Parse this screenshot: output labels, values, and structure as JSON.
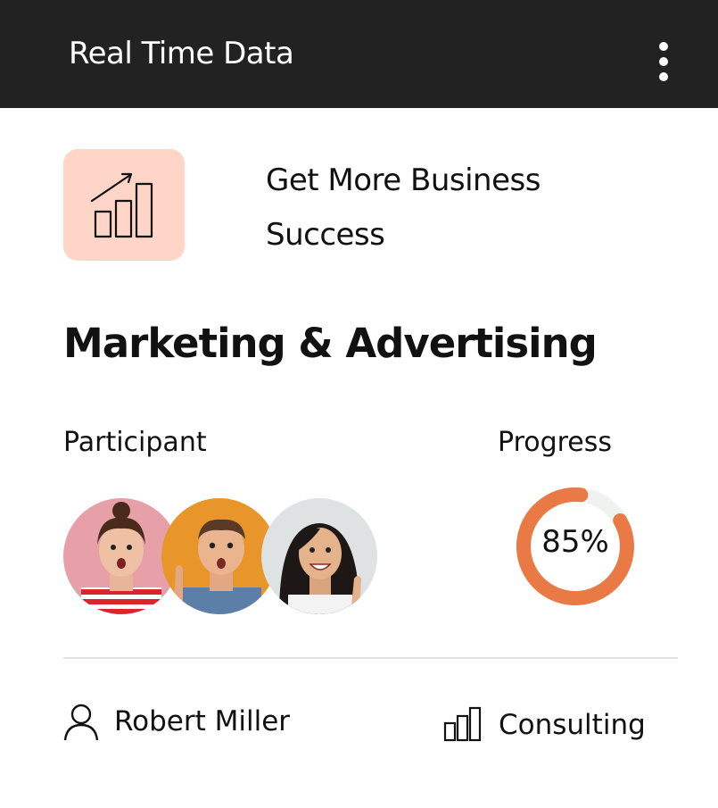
{
  "header": {
    "title": "Real Time Data",
    "menu_icon": "more-vertical-icon"
  },
  "promo": {
    "icon": "growth-chart-icon",
    "icon_bg_color": "#ffd5c7",
    "text": "Get More Business Success"
  },
  "section": {
    "title": "Marketing & Advertising"
  },
  "participants": {
    "label": "Participant",
    "avatars": [
      "avatar-woman-red-stripes",
      "avatar-man-orange-bg",
      "avatar-woman-grey-bg"
    ]
  },
  "progress": {
    "label": "Progress",
    "value_text": "85%",
    "value": 85,
    "color": "#ea7a45",
    "track_color": "#eef3ef"
  },
  "footer": {
    "owner_icon": "user-icon",
    "owner_name": "Robert Miller",
    "category_icon": "bar-chart-icon",
    "category_name": "Consulting"
  }
}
